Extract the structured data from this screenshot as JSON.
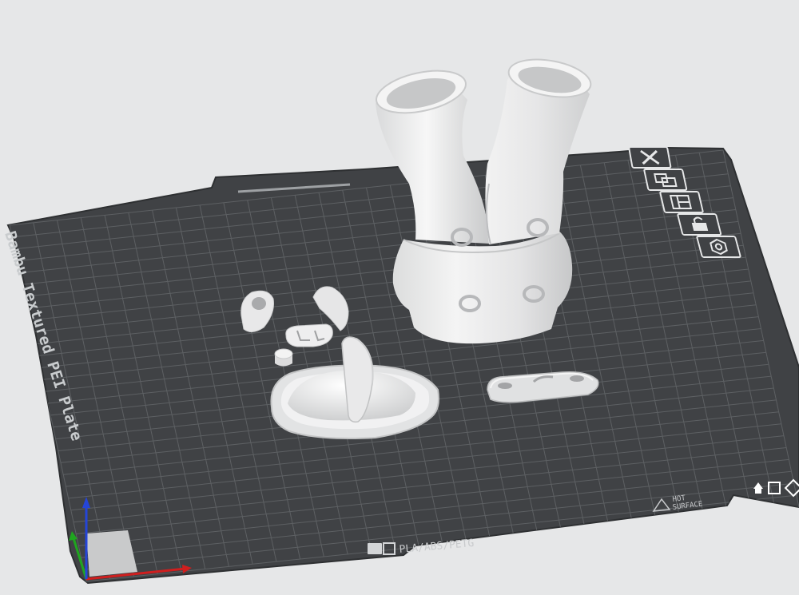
{
  "plate": {
    "name": "Bambu Textured PEI Plate",
    "materials": "PLA/ABS/PETG",
    "hot_line1": "HOT",
    "hot_line2": "SURFACE"
  },
  "toolbar": {
    "items": [
      {
        "id": "delete",
        "icon": "delete-x-icon"
      },
      {
        "id": "arrange",
        "icon": "arrange-icon"
      },
      {
        "id": "layout",
        "icon": "plate-layout-icon"
      },
      {
        "id": "lock",
        "icon": "lock-icon"
      },
      {
        "id": "settings",
        "icon": "settings-nut-icon"
      }
    ]
  },
  "colors": {
    "plate": "#404245",
    "grid": "#5d6063",
    "model": "#ececed",
    "axis_x": "#d01e1e",
    "axis_y": "#1fa51f",
    "axis_z": "#2545d8"
  }
}
